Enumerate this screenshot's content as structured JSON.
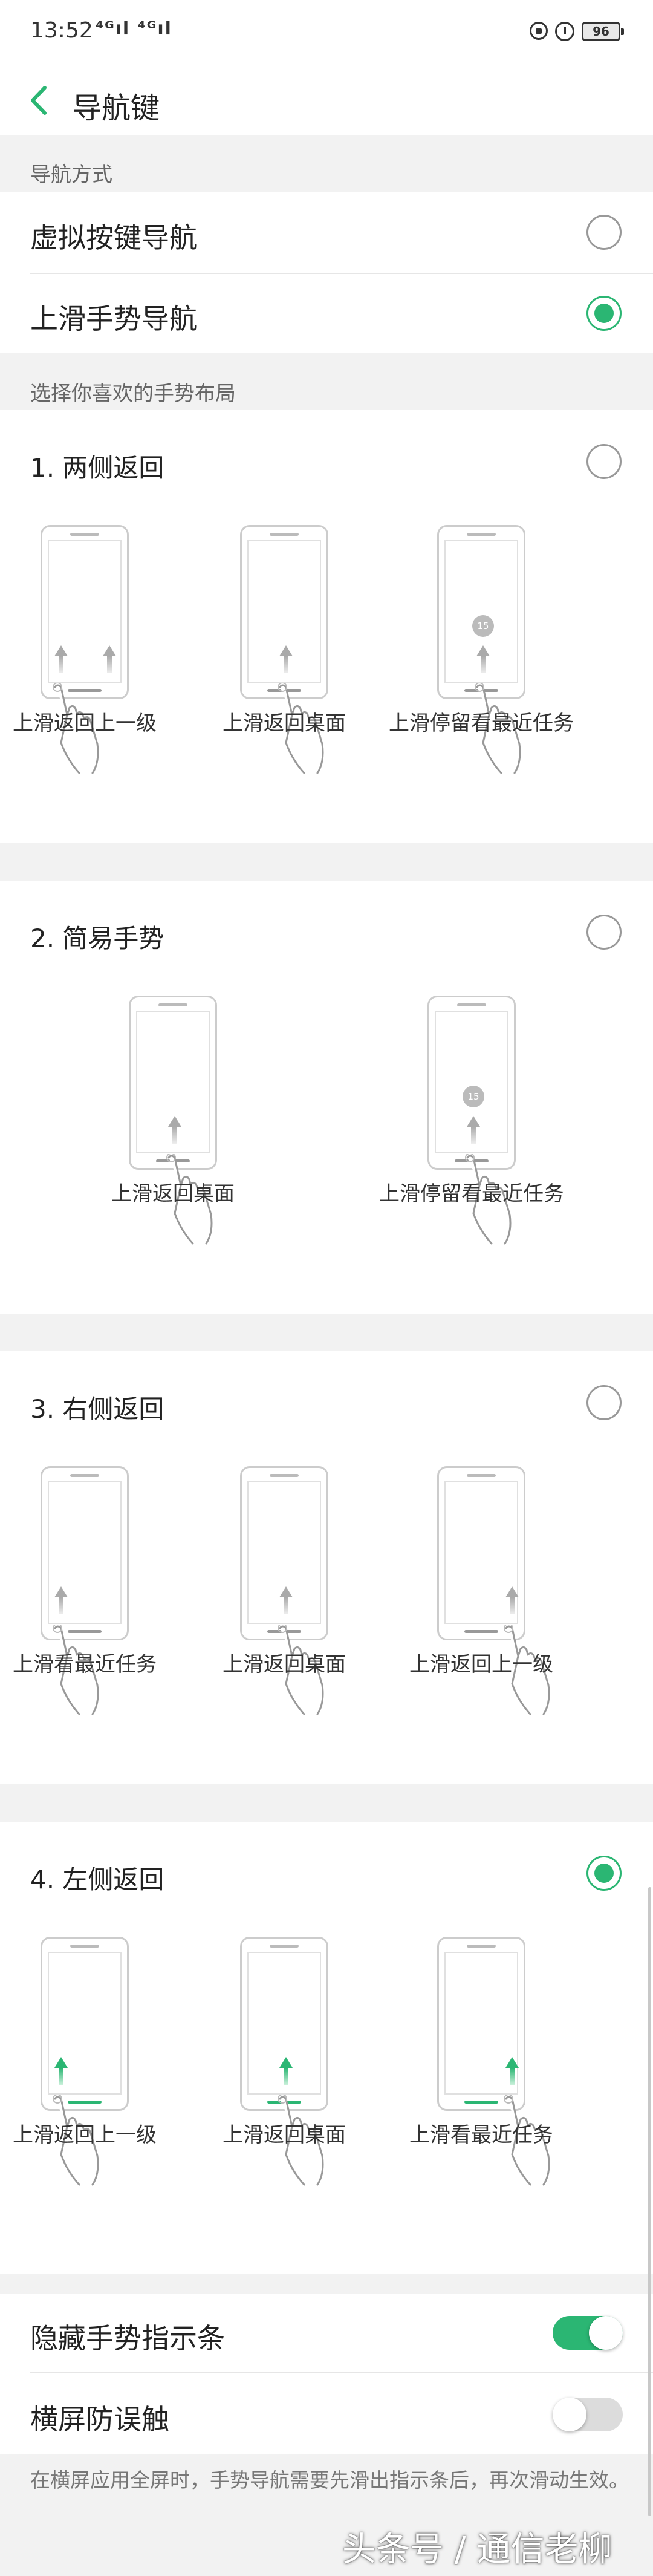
{
  "status_bar": {
    "time": "13:52",
    "signals": "⁴ᴳıl ⁴ᴳıl",
    "battery": "96"
  },
  "header": {
    "title": "导航键",
    "back_icon": "chevron-left-icon"
  },
  "nav_mode": {
    "label": "导航方式",
    "options": [
      {
        "label": "虚拟按键导航",
        "checked": false
      },
      {
        "label": "上滑手势导航",
        "checked": true
      }
    ]
  },
  "gesture_layout": {
    "label": "选择你喜欢的手势布局",
    "layouts": [
      {
        "title": "1. 两侧返回",
        "checked": false,
        "captions": [
          "上滑返回上一级",
          "上滑返回桌面",
          "上滑停留看最近任务"
        ]
      },
      {
        "title": "2. 简易手势",
        "checked": false,
        "captions": [
          "上滑返回桌面",
          "上滑停留看最近任务"
        ]
      },
      {
        "title": "3. 右侧返回",
        "checked": false,
        "captions": [
          "上滑看最近任务",
          "上滑返回桌面",
          "上滑返回上一级"
        ]
      },
      {
        "title": "4. 左侧返回",
        "checked": true,
        "captions": [
          "上滑返回上一级",
          "上滑返回桌面",
          "上滑看最近任务"
        ]
      }
    ],
    "badge_text": "15"
  },
  "settings": {
    "hide_indicator": {
      "label": "隐藏手势指示条",
      "enabled": true
    },
    "landscape_protect": {
      "label": "横屏防误触",
      "enabled": false
    }
  },
  "footnote": "在横屏应用全屏时，手势导航需要先滑出指示条后，再次滑动生效。",
  "watermark": "头条号 / 通信老柳",
  "colors": {
    "accent": "#2bb673",
    "background": "#ffffff",
    "section_bg": "#f2f2f2"
  }
}
